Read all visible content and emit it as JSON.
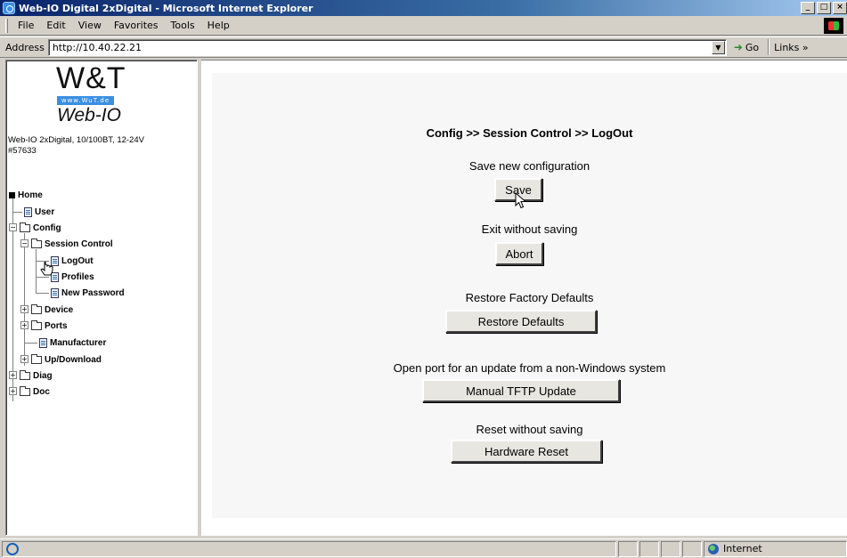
{
  "window": {
    "title": "Web-IO Digital 2xDigital - Microsoft Internet Explorer",
    "buttons": [
      "_",
      "□",
      "×"
    ]
  },
  "menu": {
    "items": [
      {
        "label": "File"
      },
      {
        "label": "Edit"
      },
      {
        "label": "View"
      },
      {
        "label": "Favorites"
      },
      {
        "label": "Tools"
      },
      {
        "label": "Help"
      }
    ]
  },
  "address": {
    "label": "Address",
    "url": "http://10.40.22.21",
    "go_label": "Go",
    "links_label": "Links »"
  },
  "sidebar": {
    "logo_wt": "W&T",
    "logo_url": "www.WuT.de",
    "logo_product": "Web-IO",
    "device_line1": "Web-IO 2xDigital, 10/100BT, 12-24V",
    "device_line2": "#57633",
    "tree": {
      "home": "Home",
      "user": "User",
      "config": "Config",
      "session_control": "Session Control",
      "logout": "LogOut",
      "profiles": "Profiles",
      "new_password": "New Password",
      "device": "Device",
      "ports": "Ports",
      "manufacturer": "Manufacturer",
      "updownload": "Up/Download",
      "diag": "Diag",
      "doc": "Doc"
    }
  },
  "main": {
    "breadcrumb": "Config >> Session Control >> LogOut",
    "sections": {
      "save": {
        "caption": "Save new configuration",
        "button": "Save"
      },
      "abort": {
        "caption": "Exit without saving",
        "button": "Abort"
      },
      "restore": {
        "caption": "Restore Factory Defaults",
        "button": "Restore Defaults"
      },
      "tftp": {
        "caption": "Open port for an update from a non-Windows system",
        "button": "Manual TFTP Update"
      },
      "reset": {
        "caption": "Reset without saving",
        "button": "Hardware Reset"
      }
    }
  },
  "status": {
    "zone": "Internet"
  },
  "icons": {
    "app": "ie-icon",
    "folder": "folder-icon",
    "page": "page-icon",
    "zone": "globe-icon"
  }
}
